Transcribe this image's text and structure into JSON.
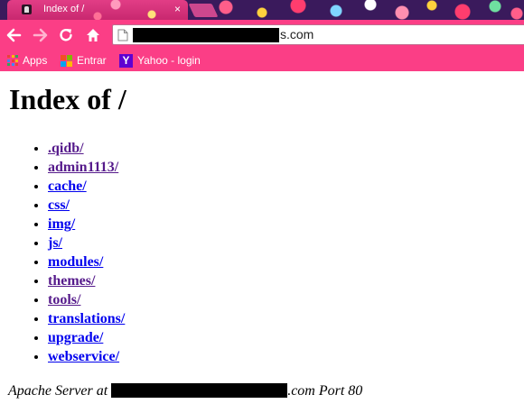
{
  "tab": {
    "title": "Index of /",
    "close": "×"
  },
  "address_bar": {
    "url_visible": "s.com"
  },
  "bookmarks": [
    {
      "label": "Apps",
      "icon": "apps-grid-icon"
    },
    {
      "label": "Entrar",
      "icon": "windows-logo-icon"
    },
    {
      "label": "Yahoo - login",
      "icon": "yahoo-logo-icon",
      "logo_letter": "Y"
    }
  ],
  "page": {
    "title": "Index of /",
    "entries": [
      {
        "label": ".qidb/",
        "visited": true
      },
      {
        "label": "admin1113/",
        "visited": true
      },
      {
        "label": "cache/",
        "visited": false
      },
      {
        "label": "css/",
        "visited": false
      },
      {
        "label": "img/",
        "visited": false
      },
      {
        "label": "js/",
        "visited": false
      },
      {
        "label": "modules/",
        "visited": false
      },
      {
        "label": "themes/",
        "visited": true
      },
      {
        "label": "tools/",
        "visited": true
      },
      {
        "label": "translations/",
        "visited": false
      },
      {
        "label": "upgrade/",
        "visited": false
      },
      {
        "label": "webservice/",
        "visited": false
      }
    ],
    "footer": {
      "prefix": "Apache Server at ",
      "suffix": ".com Port 80"
    }
  },
  "colors": {
    "chrome_pink": "#fb3e86",
    "link_visited": "#551a8b",
    "link_unvisited": "#0000ee"
  }
}
